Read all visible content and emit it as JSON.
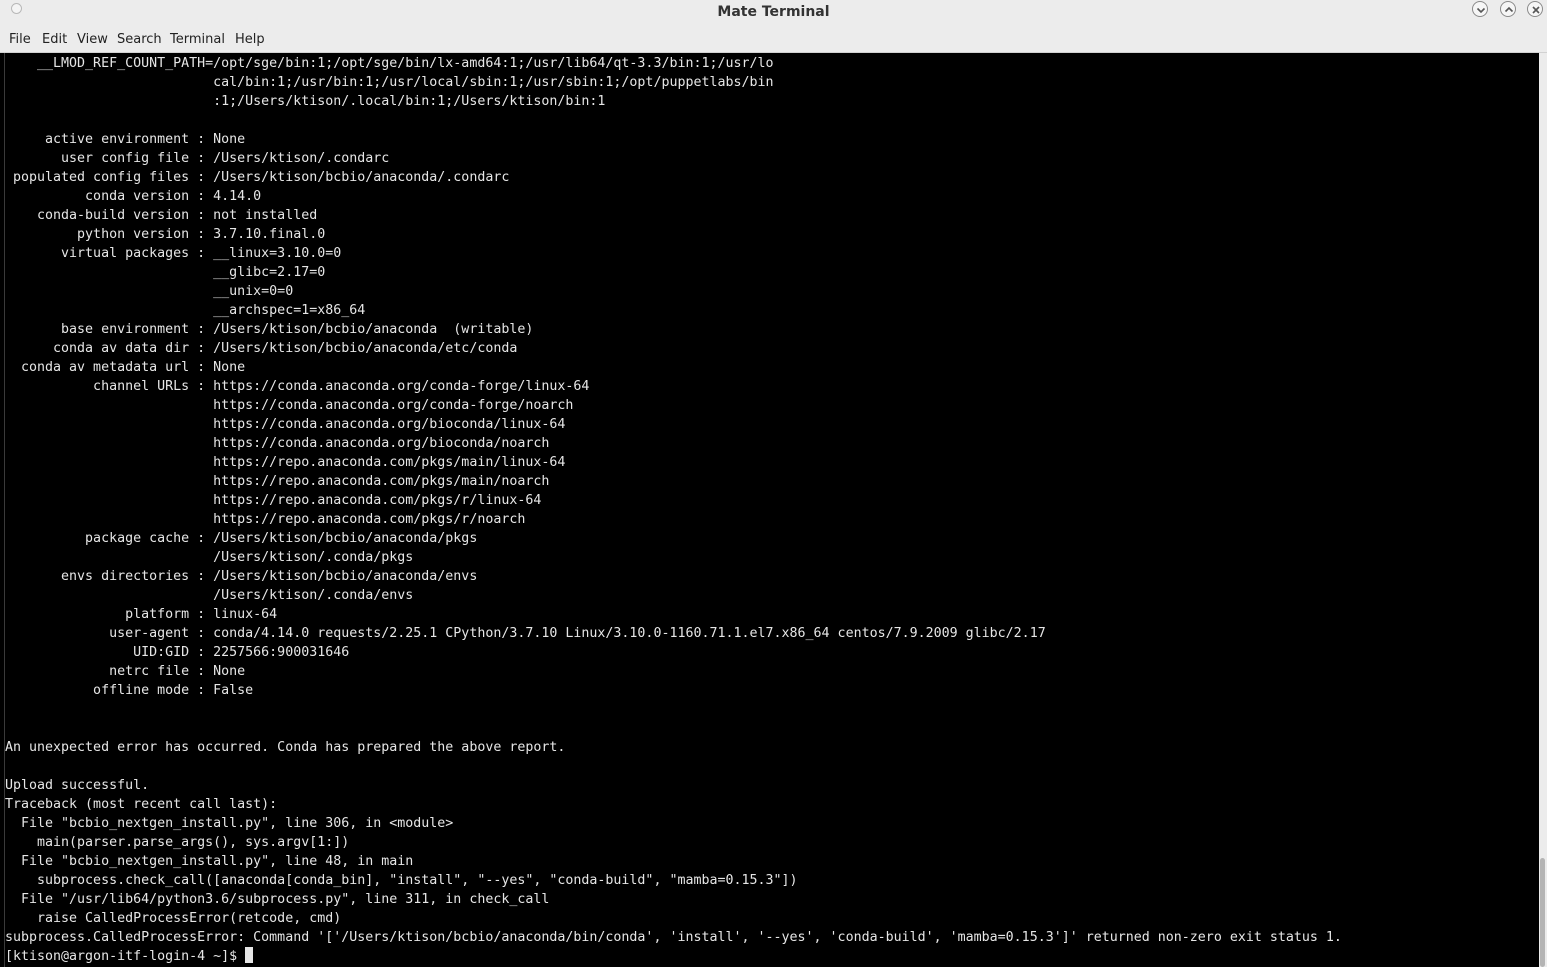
{
  "window": {
    "title": "Mate Terminal"
  },
  "menubar": {
    "items": [
      {
        "label": "File"
      },
      {
        "label": "Edit"
      },
      {
        "label": "View"
      },
      {
        "label": "Search"
      },
      {
        "label": "Terminal"
      },
      {
        "label": "Help"
      }
    ]
  },
  "titlebar_buttons": {
    "minimize_icon": "chevron-down-icon",
    "maximize_icon": "chevron-up-icon",
    "close_icon": "close-icon"
  },
  "terminal": {
    "lines": [
      "    __LMOD_REF_COUNT_PATH=/opt/sge/bin:1;/opt/sge/bin/lx-amd64:1;/usr/lib64/qt-3.3/bin:1;/usr/lo",
      "                          cal/bin:1;/usr/bin:1;/usr/local/sbin:1;/usr/sbin:1;/opt/puppetlabs/bin",
      "                          :1;/Users/ktison/.local/bin:1;/Users/ktison/bin:1",
      "",
      "     active environment : None",
      "       user config file : /Users/ktison/.condarc",
      " populated config files : /Users/ktison/bcbio/anaconda/.condarc",
      "          conda version : 4.14.0",
      "    conda-build version : not installed",
      "         python version : 3.7.10.final.0",
      "       virtual packages : __linux=3.10.0=0",
      "                          __glibc=2.17=0",
      "                          __unix=0=0",
      "                          __archspec=1=x86_64",
      "       base environment : /Users/ktison/bcbio/anaconda  (writable)",
      "      conda av data dir : /Users/ktison/bcbio/anaconda/etc/conda",
      "  conda av metadata url : None",
      "           channel URLs : https://conda.anaconda.org/conda-forge/linux-64",
      "                          https://conda.anaconda.org/conda-forge/noarch",
      "                          https://conda.anaconda.org/bioconda/linux-64",
      "                          https://conda.anaconda.org/bioconda/noarch",
      "                          https://repo.anaconda.com/pkgs/main/linux-64",
      "                          https://repo.anaconda.com/pkgs/main/noarch",
      "                          https://repo.anaconda.com/pkgs/r/linux-64",
      "                          https://repo.anaconda.com/pkgs/r/noarch",
      "          package cache : /Users/ktison/bcbio/anaconda/pkgs",
      "                          /Users/ktison/.conda/pkgs",
      "       envs directories : /Users/ktison/bcbio/anaconda/envs",
      "                          /Users/ktison/.conda/envs",
      "               platform : linux-64",
      "             user-agent : conda/4.14.0 requests/2.25.1 CPython/3.7.10 Linux/3.10.0-1160.71.1.el7.x86_64 centos/7.9.2009 glibc/2.17",
      "                UID:GID : 2257566:900031646",
      "             netrc file : None",
      "           offline mode : False",
      "",
      "",
      "An unexpected error has occurred. Conda has prepared the above report.",
      "",
      "Upload successful.",
      "Traceback (most recent call last):",
      "  File \"bcbio_nextgen_install.py\", line 306, in <module>",
      "    main(parser.parse_args(), sys.argv[1:])",
      "  File \"bcbio_nextgen_install.py\", line 48, in main",
      "    subprocess.check_call([anaconda[conda_bin], \"install\", \"--yes\", \"conda-build\", \"mamba=0.15.3\"])",
      "  File \"/usr/lib64/python3.6/subprocess.py\", line 311, in check_call",
      "    raise CalledProcessError(retcode, cmd)",
      "subprocess.CalledProcessError: Command '['/Users/ktison/bcbio/anaconda/bin/conda', 'install', '--yes', 'conda-build', 'mamba=0.15.3']' returned non-zero exit status 1."
    ],
    "prompt": "[ktison@argon-itf-login-4 ~]$ "
  },
  "colors": {
    "background": "#000000",
    "foreground": "#e6e6e6",
    "chrome": "#ececec"
  }
}
